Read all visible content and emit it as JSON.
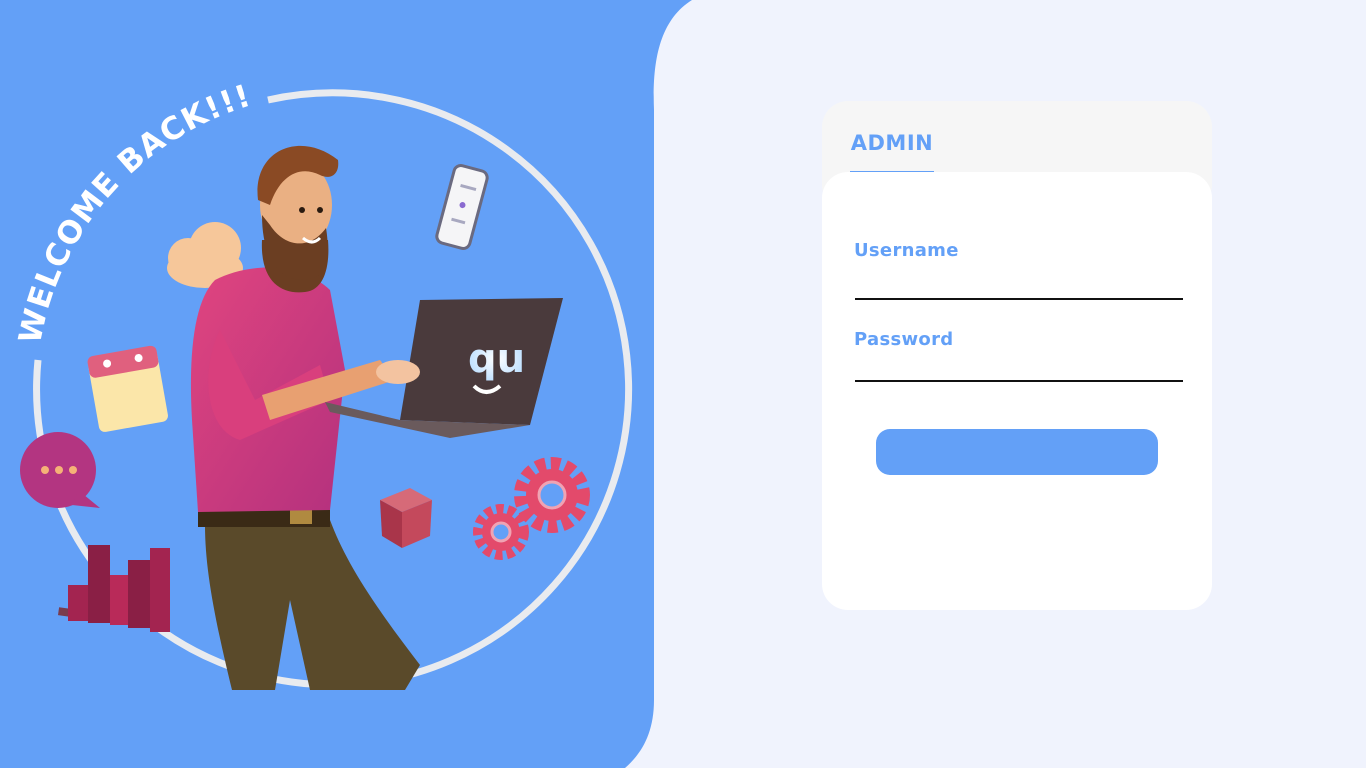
{
  "hero": {
    "greeting": "WELCOME BACK!!!",
    "laptop_logo": "qu"
  },
  "login": {
    "tab_label": "ADMIN",
    "username_label": "Username",
    "username_value": "",
    "password_label": "Password",
    "password_value": "",
    "submit_label": ""
  },
  "colors": {
    "accent": "#63a0f7",
    "page_background": "#f0f3fd",
    "card_background": "#ffffff",
    "tab_bar_background": "#f6f6f6"
  }
}
